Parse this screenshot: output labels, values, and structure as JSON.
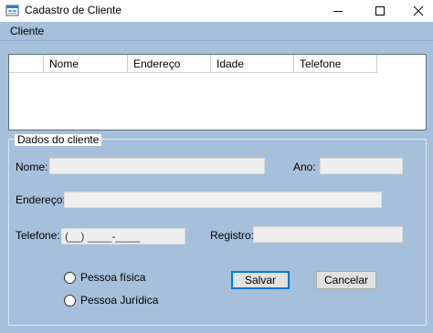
{
  "window": {
    "title": "Cadastro de Cliente"
  },
  "menu": {
    "items": [
      {
        "label": "Cliente"
      }
    ]
  },
  "listview": {
    "columns": [
      {
        "label": ""
      },
      {
        "label": "Nome"
      },
      {
        "label": "Endereço"
      },
      {
        "label": "Idade"
      },
      {
        "label": "Telefone"
      }
    ]
  },
  "form": {
    "group_title": "Dados do cliente",
    "nome_label": "Nome:",
    "nome_value": "",
    "ano_label": "Ano:",
    "ano_value": "",
    "endereco_label": "Endereço:",
    "endereco_value": "",
    "telefone_label": "Telefone:",
    "telefone_mask": "(__) ____-____",
    "registro_label": "Registro:",
    "registro_value": "",
    "radio_fisica": "Pessoa física",
    "radio_juridica": "Pessoa Jurídica",
    "salvar_label": "Salvar",
    "cancelar_label": "Cancelar"
  },
  "icons": {
    "app": "app-form-icon",
    "minimize": "minimize-icon",
    "maximize": "maximize-icon",
    "close": "close-icon"
  },
  "colors": {
    "background_blue": "#a6bfdb",
    "focus_border": "#0078d7"
  }
}
